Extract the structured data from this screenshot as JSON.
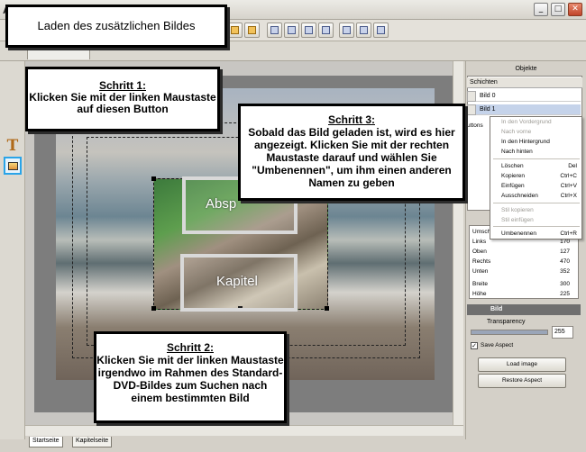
{
  "window": {
    "title_letter": "A",
    "min_glyph": "_",
    "max_glyph": "□",
    "close_glyph": "✕"
  },
  "tutorial": {
    "header": "Laden des zusätzlichen Bildes"
  },
  "callouts": {
    "step1": {
      "title": "Schritt 1:",
      "body": "Klicken Sie mit der linken Maustaste auf diesen Button"
    },
    "step2": {
      "title": "Schritt 2:",
      "body": "Klicken Sie mit der linken Maustaste irgendwo im Rahmen des Standard-DVD-Bildes zum Suchen nach einem bestimmten Bild"
    },
    "step3": {
      "title": "Schritt 3:",
      "body": "Sobald das Bild geladen ist, wird es hier angezeigt. Klicken Sie mit der rechten Maustaste darauf und wählen Sie \"Umbenennen\",  um ihm einen anderen Namen zu geben"
    }
  },
  "canvas": {
    "button1_label": "Absp",
    "button2_label": "Kapitel"
  },
  "page_tabs": [
    "Startseite",
    "Kapitelseite"
  ],
  "panel": {
    "title": "Objekte",
    "layers_header": "Schichten",
    "layers": [
      "Bild 0",
      "Bild 1"
    ],
    "side_tab": "uttons",
    "context_menu": [
      {
        "label": "In den Vordergrund",
        "shortcut": "",
        "disabled": true
      },
      {
        "label": "Nach vorne",
        "shortcut": "",
        "disabled": true
      },
      {
        "label": "In den Hintergrund",
        "shortcut": "",
        "disabled": false
      },
      {
        "label": "Nach hinten",
        "shortcut": "",
        "disabled": false
      },
      {
        "label": "Löschen",
        "shortcut": "Del",
        "disabled": false
      },
      {
        "label": "Kopieren",
        "shortcut": "Ctrl+C",
        "disabled": false
      },
      {
        "label": "Einfügen",
        "shortcut": "Ctrl+V",
        "disabled": false
      },
      {
        "label": "Ausschneiden",
        "shortcut": "Ctrl+X",
        "disabled": false
      },
      {
        "label": "Stil kopieren",
        "shortcut": "",
        "disabled": true
      },
      {
        "label": "Stil einfügen",
        "shortcut": "",
        "disabled": true
      },
      {
        "label": "Umbenennen",
        "shortcut": "Ctrl+R",
        "disabled": false
      }
    ],
    "position": {
      "label": "Umsch",
      "rows": [
        {
          "label": "Links",
          "value": "170"
        },
        {
          "label": "Oben",
          "value": "127"
        },
        {
          "label": "Rechts",
          "value": "470"
        },
        {
          "label": "Unten",
          "value": "352"
        },
        {
          "label": "Breite",
          "value": "300"
        },
        {
          "label": "Höhe",
          "value": "225"
        }
      ]
    },
    "bild_section": "Bild",
    "transparency_label": "Transparency",
    "transparency_value": "255",
    "transparency_level": 1.0,
    "save_aspect_label": "Save Aspect",
    "save_aspect_checked": true,
    "load_image_button": "Load image",
    "restore_aspect_button": "Restore Aspect"
  },
  "colors": {
    "highlight": "#2aa4e8",
    "section_header": "#6f6f6f",
    "selection": "#c5d3ea"
  }
}
